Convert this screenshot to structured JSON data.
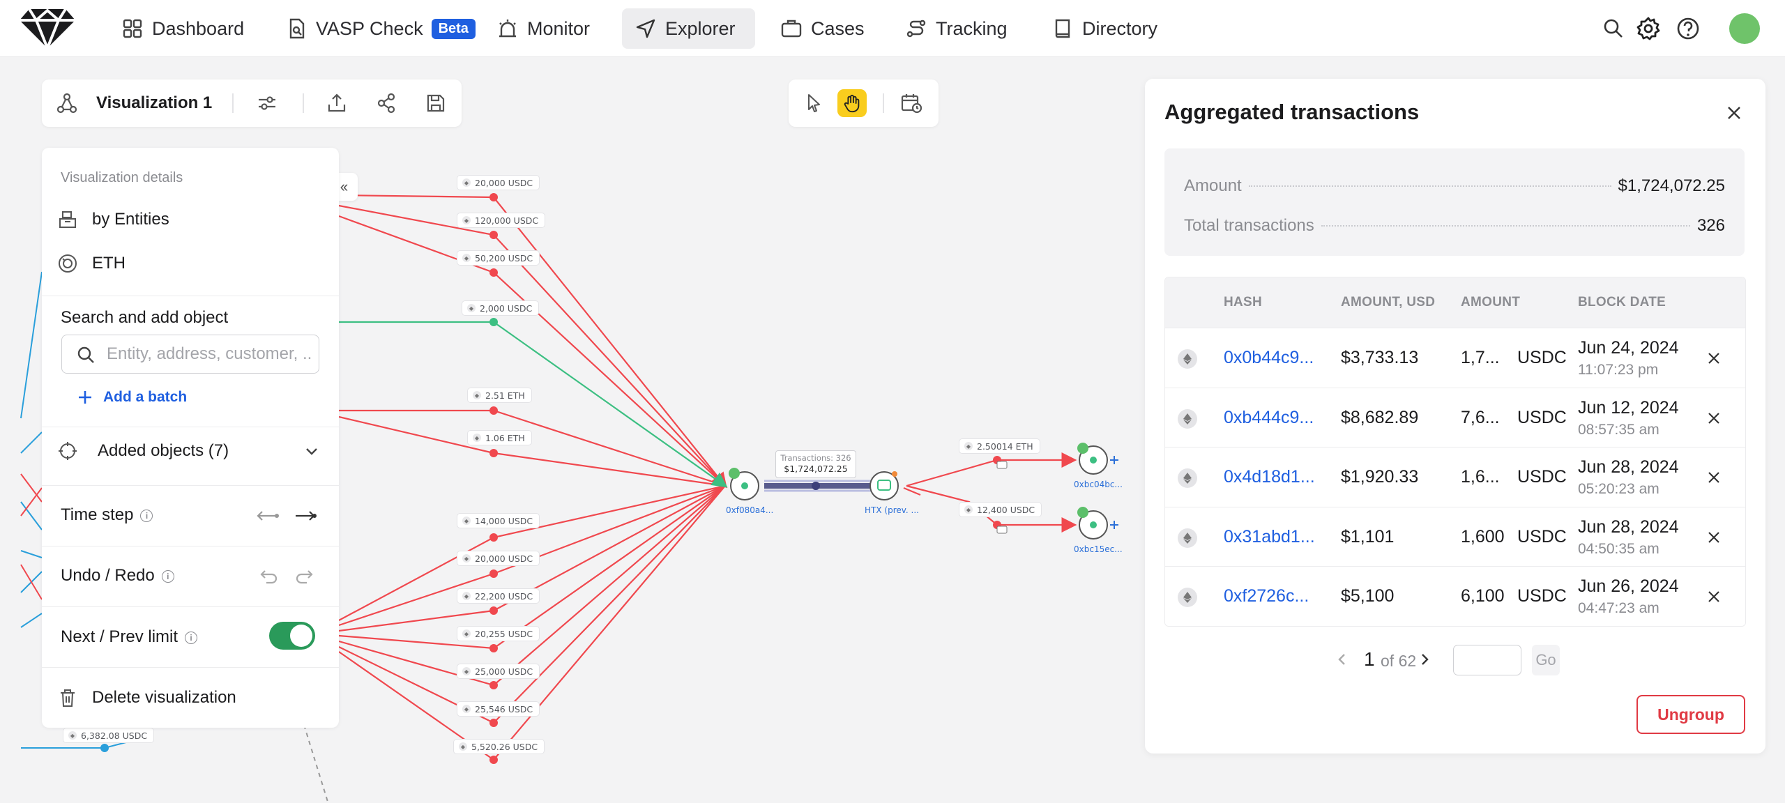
{
  "nav": {
    "items": [
      {
        "label": "Dashboard"
      },
      {
        "label": "VASP Check",
        "badge": "Beta"
      },
      {
        "label": "Monitor"
      },
      {
        "label": "Explorer"
      },
      {
        "label": "Cases"
      },
      {
        "label": "Tracking"
      },
      {
        "label": "Directory"
      }
    ],
    "active": "Explorer",
    "icons": [
      "search-icon",
      "gear-icon",
      "help-icon"
    ],
    "avatar_color": "#6fc36a"
  },
  "toolbar": {
    "title": "Visualization 1",
    "icons": [
      "visualization-icon",
      "filter-icon",
      "export-icon",
      "share-icon",
      "save-icon"
    ]
  },
  "tools": {
    "icons": [
      "pointer-icon",
      "hand-icon",
      "calendar-icon"
    ],
    "active": "hand-icon",
    "active_color": "#f9cd1e"
  },
  "details": {
    "heading": "Visualization details",
    "group_by": "by Entities",
    "network": "ETH",
    "search_label": "Search and add object",
    "search_placeholder": "Entity, address, customer, ...",
    "add_batch": "Add a batch",
    "added_objects": "Added objects (7)",
    "time_step": "Time step",
    "undo_redo": "Undo / Redo",
    "next_prev_limit": "Next / Prev limit",
    "next_prev_enabled": true,
    "delete": "Delete visualization"
  },
  "graph": {
    "edge_labels": [
      "20,000 USDC",
      "120,000 USDC",
      "50,200 USDC",
      "2,000 USDC",
      "2.51 ETH",
      "1.06 ETH",
      "14,000 USDC",
      "20,000 USDC",
      "22,200 USDC",
      "20,255 USDC",
      "25,000 USDC",
      "25,546 USDC",
      "5,520.26 USDC",
      "6,382.08 USDC",
      "2.50014 ETH",
      "12,400 USDC"
    ],
    "aggregate_title": "Transactions: 326",
    "aggregate_amount": "$1,724,072.25",
    "nodes": {
      "source": {
        "label": "0xf080a4...",
        "badge": "5"
      },
      "htx": {
        "label": "HTX (prev. ..."
      },
      "out1": {
        "label": "0xbc04bc...",
        "badge": "4"
      },
      "out2": {
        "label": "0xbc15ec...",
        "badge": "5"
      }
    },
    "colors": {
      "red": "#f0484e",
      "green": "#3cbf82",
      "blue": "#2a9fdb",
      "purple": "#3c3f7a"
    }
  },
  "aggregated": {
    "title": "Aggregated transactions",
    "amount_label": "Amount",
    "amount_value": "$1,724,072.25",
    "total_label": "Total transactions",
    "total_value": "326",
    "columns": [
      "HASH",
      "AMOUNT, USD",
      "AMOUNT",
      "BLOCK DATE"
    ],
    "rows": [
      {
        "hash": "0x0b44c9...",
        "usd": "$3,733.13",
        "amount": "1,7...",
        "currency": "USDC",
        "date": "Jun 24, 2024",
        "time": "11:07:23 pm"
      },
      {
        "hash": "0xb444c9...",
        "usd": "$8,682.89",
        "amount": "7,6...",
        "currency": "USDC",
        "date": "Jun 12, 2024",
        "time": "08:57:35 am"
      },
      {
        "hash": "0x4d18d1...",
        "usd": "$1,920.33",
        "amount": "1,6...",
        "currency": "USDC",
        "date": "Jun 28, 2024",
        "time": "05:20:23 am"
      },
      {
        "hash": "0x31abd1...",
        "usd": "$1,101",
        "amount": "1,600",
        "currency": "USDC",
        "date": "Jun 28, 2024",
        "time": "04:50:35 am"
      },
      {
        "hash": "0xf2726c...",
        "usd": "$5,100",
        "amount": "6,100",
        "currency": "USDC",
        "date": "Jun 26, 2024",
        "time": "04:47:23 am"
      }
    ],
    "page": "1",
    "page_of": "of 62",
    "go": "Go",
    "ungroup": "Ungroup"
  }
}
